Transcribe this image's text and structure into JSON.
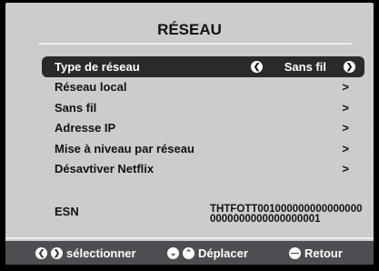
{
  "title": "RÉSEAU",
  "menu": {
    "items": [
      {
        "label": "Type de réseau",
        "value": "Sans fil"
      },
      {
        "label": "Réseau local",
        "arrow": ">"
      },
      {
        "label": "Sans fil",
        "arrow": ">"
      },
      {
        "label": "Adresse IP",
        "arrow": ">"
      },
      {
        "label": "Mise à niveau par réseau",
        "arrow": ">"
      },
      {
        "label": "Désavtiver Netflix",
        "arrow": ">"
      }
    ]
  },
  "esn": {
    "label": "ESN",
    "value": "THTFOTT0010000000000000000000000000000000001"
  },
  "footer": {
    "select": "sélectionner",
    "move": "Déplacer",
    "back": "Retour"
  }
}
